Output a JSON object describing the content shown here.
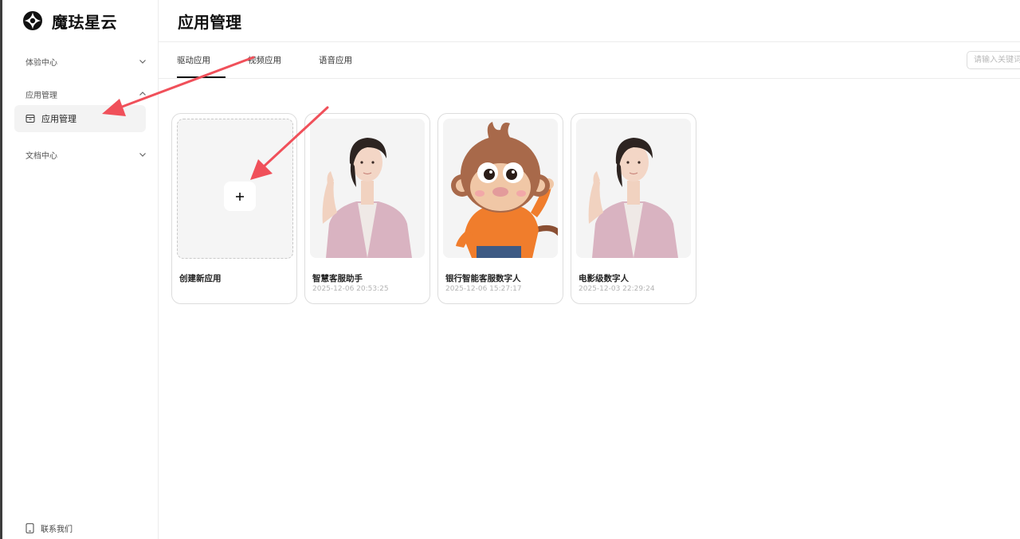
{
  "brand": {
    "name": "魔珐星云",
    "logo_icon": "brand-logo-icon"
  },
  "sidebar": {
    "groups": [
      {
        "label": "体验中心",
        "icon": "chevron-down-icon"
      },
      {
        "label": "应用管理",
        "icon": "chevron-up-icon"
      },
      {
        "label": "文档中心",
        "icon": "chevron-down-icon"
      }
    ],
    "active_item": {
      "label": "应用管理",
      "icon": "app-box-icon"
    },
    "contact": {
      "label": "联系我们",
      "icon": "phone-icon"
    }
  },
  "page": {
    "title": "应用管理"
  },
  "tabs": [
    {
      "label": "驱动应用",
      "active": true
    },
    {
      "label": "视频应用",
      "active": false
    },
    {
      "label": "语音应用",
      "active": false
    }
  ],
  "search": {
    "placeholder": "请输入关键词"
  },
  "create_card": {
    "label": "创建新应用",
    "icon": "plus-icon"
  },
  "apps": [
    {
      "name": "智慧客服助手",
      "time": "2025-12-06 20:53:25",
      "avatar": "female-avatar"
    },
    {
      "name": "银行智能客服数字人",
      "time": "2025-12-06 15:27:17",
      "avatar": "monkey-avatar"
    },
    {
      "name": "电影级数字人",
      "time": "2025-12-03 22:29:24",
      "avatar": "female-avatar"
    }
  ],
  "colors": {
    "annotation_arrow": "#f0505a",
    "active_bg": "#f3f3f3",
    "card_border": "#dddddd"
  }
}
